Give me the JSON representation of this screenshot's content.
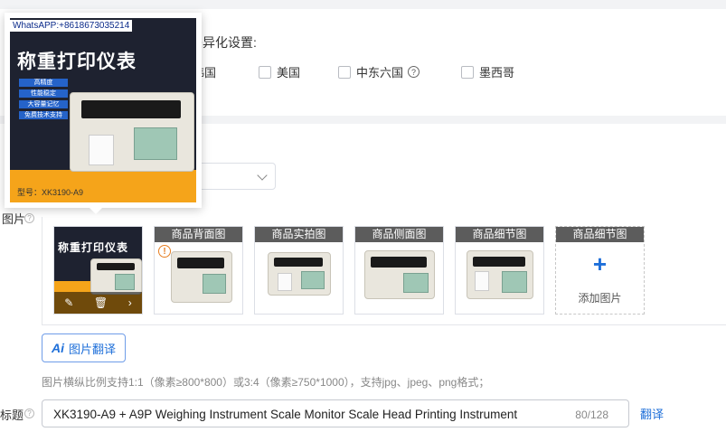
{
  "diff_settings": {
    "title": "差异化设置:",
    "options": [
      {
        "label": "韩国",
        "checked": false
      },
      {
        "label": "美国",
        "checked": false
      },
      {
        "label": "中东六国",
        "checked": false,
        "help": true
      },
      {
        "label": "墨西哥",
        "checked": false
      }
    ]
  },
  "images": {
    "side_label": "图片",
    "slots": [
      {
        "title": "",
        "type": "main"
      },
      {
        "title": "商品背面图",
        "type": "image",
        "warning": true
      },
      {
        "title": "商品实拍图",
        "type": "image"
      },
      {
        "title": "商品侧面图",
        "type": "image"
      },
      {
        "title": "商品细节图",
        "type": "image"
      },
      {
        "title": "商品细节图",
        "type": "add",
        "add_label": "添加图片"
      }
    ],
    "translate_button": "图片翻译",
    "hint": "图片横纵比例支持1:1（像素≥800*800）或3:4（像素≥750*1000），支持jpg、jpeg、png格式；"
  },
  "preview": {
    "whatsapp": "WhatsAPP:+8618673035214",
    "headline": "称重打印仪表",
    "features": [
      "高精度",
      "性能稳定",
      "大容量记忆",
      "免费技术支持"
    ],
    "model": "型号：XK3190-A9"
  },
  "title_field": {
    "side_label": "标题",
    "value": "XK3190-A9 + A9P Weighing Instrument Scale Monitor Scale Head Printing Instrument",
    "count": "80/128",
    "translate": "翻译"
  },
  "icons": {
    "help": "question-circle-icon",
    "edit": "edit-icon",
    "delete": "trash-icon",
    "next": "chevron-right-icon",
    "add": "plus-icon",
    "warning": "warning-circle-icon"
  },
  "colors": {
    "accent": "#1e6fd9",
    "thumb_title_bg": "#5c5c5c",
    "warning": "#e67e22"
  }
}
